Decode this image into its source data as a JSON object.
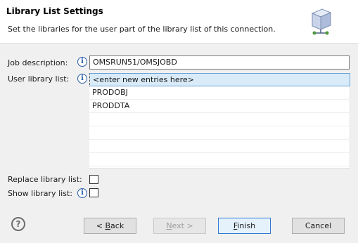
{
  "header": {
    "title": "Library List Settings",
    "description": "Set the libraries for the user part of the library list of this connection.",
    "icon": "wizard-server-banner-icon"
  },
  "form": {
    "job_description_label": "Job description:",
    "job_description_value": "OMSRUN51/OMSJOBD",
    "user_library_list_label": "User library list:",
    "library_entries": [
      "<enter new entries here>",
      "PRODOBJ",
      "PRODDTA"
    ],
    "replace_library_list_label": "Replace library list:",
    "replace_library_list_checked": false,
    "show_library_list_label": "Show library list:",
    "show_library_list_checked": false,
    "info_icon": "info-icon"
  },
  "buttons": {
    "help_icon": "?",
    "back": {
      "prefix": "< ",
      "mnemonic": "B",
      "rest": "ack"
    },
    "next": {
      "mnemonic": "N",
      "rest": "ext >"
    },
    "finish": {
      "mnemonic": "F",
      "rest": "inish"
    },
    "cancel": "Cancel"
  },
  "colors": {
    "selection_bg": "#d9ebf9",
    "default_button_border": "#2f7bd6",
    "info_blue": "#2b5fa8"
  }
}
